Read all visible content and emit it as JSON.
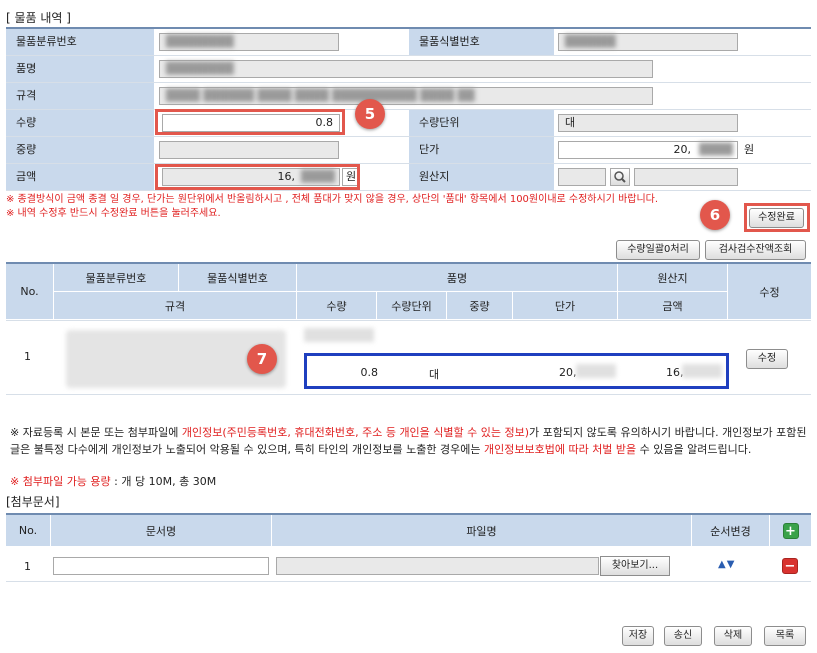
{
  "section_items": {
    "title": "[ 물품 내역 ]"
  },
  "form": {
    "classification_no_label": "물품분류번호",
    "identification_no_label": "물품식별번호",
    "item_name_label": "품명",
    "spec_label": "규격",
    "quantity_label": "수량",
    "quantity_value": "0.8",
    "quantity_unit_label": "수량단위",
    "quantity_unit_value": "대",
    "weight_label": "중량",
    "unit_price_label": "단가",
    "unit_price_value": "20,",
    "unit_price_suffix": "원",
    "amount_label": "금액",
    "amount_value": "16,",
    "amount_suffix": "원",
    "origin_label": "원산지"
  },
  "badges": {
    "b5": "5",
    "b6": "6",
    "b7": "7"
  },
  "notes": {
    "line1": "※ 종결방식이 금액 종결 일 경우, 단가는 원단위에서 반올림하시고 , 전체 품대가 맞지 않을 경우, 상단의 '품대' 항목에서 100원이내로 수정하시기 바랍니다.",
    "line2": "※ 내역 수정후 반드시 수정완료 버튼을 눌러주세요."
  },
  "buttons": {
    "edit_complete": "수정완료",
    "qty_zero": "수량일괄0처리",
    "inspect": "검사검수잔액조회",
    "row_edit": "수정",
    "browse": "찾아보기...",
    "save": "저장",
    "send": "송신",
    "delete": "삭제",
    "list": "목록"
  },
  "grid": {
    "headers": {
      "no": "No.",
      "classification_no": "물품분류번호",
      "identification_no": "물품식별번호",
      "spec": "규격",
      "item_name": "품명",
      "quantity": "수량",
      "quantity_unit": "수량단위",
      "weight": "중량",
      "unit_price": "단가",
      "origin": "원산지",
      "amount": "금액",
      "edit": "수정"
    },
    "row": {
      "no": "1",
      "quantity": "0.8",
      "unit": "대",
      "unit_price": "20,",
      "amount": "16,"
    }
  },
  "privacy": {
    "p1": "※ 자료등록 시 본문 또는 첨부파일에 ",
    "p1_red": "개인정보(주민등록번호, 휴대전화번호, 주소 등 개인을 식별할 수 있는 정보)",
    "p2": "가 포함되지 않도록 유의하시기 바랍니다. 개인정보가 포함된 글은 불특정 다수에게 개인정보가 노출되어 악용될 수 있으며, 특히 타인의 개인정보를 노출한 경우에는 ",
    "p2_red": "개인정보보호법에 따라 처벌 받을",
    "p3": " 수 있음을 알려드립니다.",
    "attach_label": "※ 첨부파일 가능 용량",
    "attach_value": " : 개 당 10M, 총 30M"
  },
  "attachments": {
    "title": "[첨부문서]",
    "headers": {
      "no": "No.",
      "doc_name": "문서명",
      "file_name": "파일명",
      "order": "순서변경"
    },
    "row_no": "1",
    "order_arrows": "▲▼",
    "add_symbol": "+",
    "remove_symbol": "−"
  },
  "colors": {
    "header_bg": "#c9d9ec",
    "highlight_red": "#e2574c",
    "highlight_blue": "#1f3fbf",
    "notice_red": "#e02020",
    "add_green": "#3aa24a",
    "remove_red": "#d9332f"
  }
}
